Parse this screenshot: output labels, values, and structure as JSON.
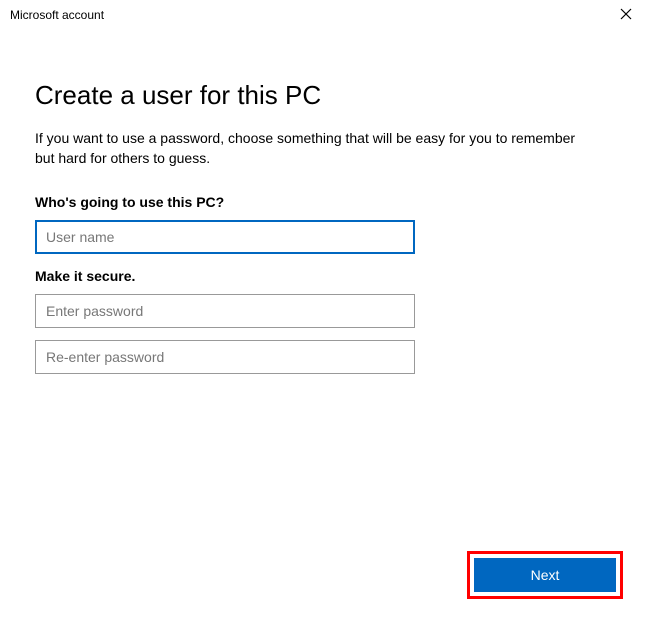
{
  "titlebar": {
    "title": "Microsoft account"
  },
  "heading": "Create a user for this PC",
  "subtext": "If you want to use a password, choose something that will be easy for you to remember but hard for others to guess.",
  "section1": {
    "label": "Who's going to use this PC?",
    "username_placeholder": "User name"
  },
  "section2": {
    "label": "Make it secure.",
    "password_placeholder": "Enter password",
    "reenter_placeholder": "Re-enter password"
  },
  "footer": {
    "next_label": "Next"
  }
}
